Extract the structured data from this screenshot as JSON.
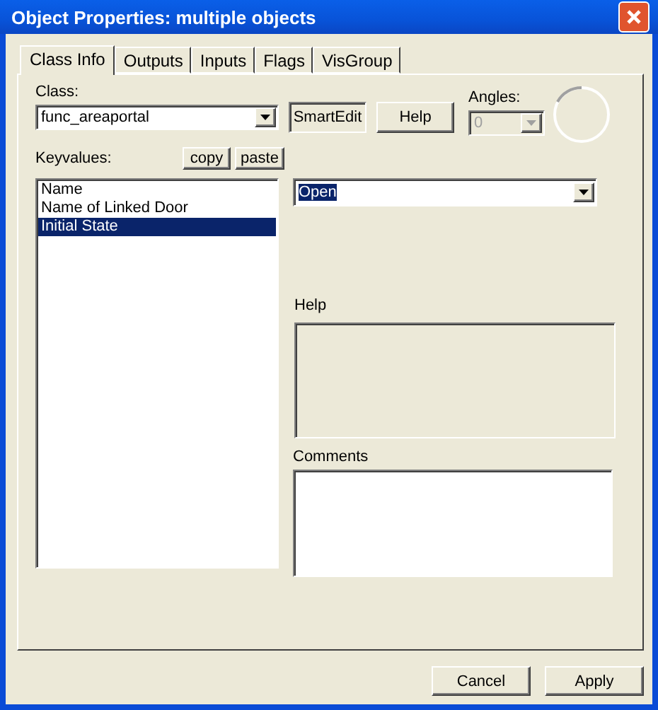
{
  "window": {
    "title": "Object Properties: multiple objects"
  },
  "tabs": [
    {
      "label": "Class Info",
      "selected": true
    },
    {
      "label": "Outputs",
      "selected": false
    },
    {
      "label": "Inputs",
      "selected": false
    },
    {
      "label": "Flags",
      "selected": false
    },
    {
      "label": "VisGroup",
      "selected": false
    }
  ],
  "class_field": {
    "label": "Class:",
    "value": "func_areaportal"
  },
  "smartedit_button": {
    "label": "SmartEdit",
    "pressed": true
  },
  "help_button": {
    "label": "Help"
  },
  "angles": {
    "label": "Angles:",
    "value": "0",
    "disabled": true
  },
  "keyvalues": {
    "label": "Keyvalues:",
    "copy": "copy",
    "paste": "paste",
    "items": [
      {
        "label": "Name",
        "selected": false
      },
      {
        "label": "Name of Linked Door",
        "selected": false
      },
      {
        "label": "Initial State",
        "selected": true
      }
    ]
  },
  "value_field": {
    "value": "Open",
    "highlighted": true
  },
  "help_box": {
    "label": "Help"
  },
  "comments_box": {
    "label": "Comments"
  },
  "buttons": [
    "Cancel",
    "Apply"
  ]
}
